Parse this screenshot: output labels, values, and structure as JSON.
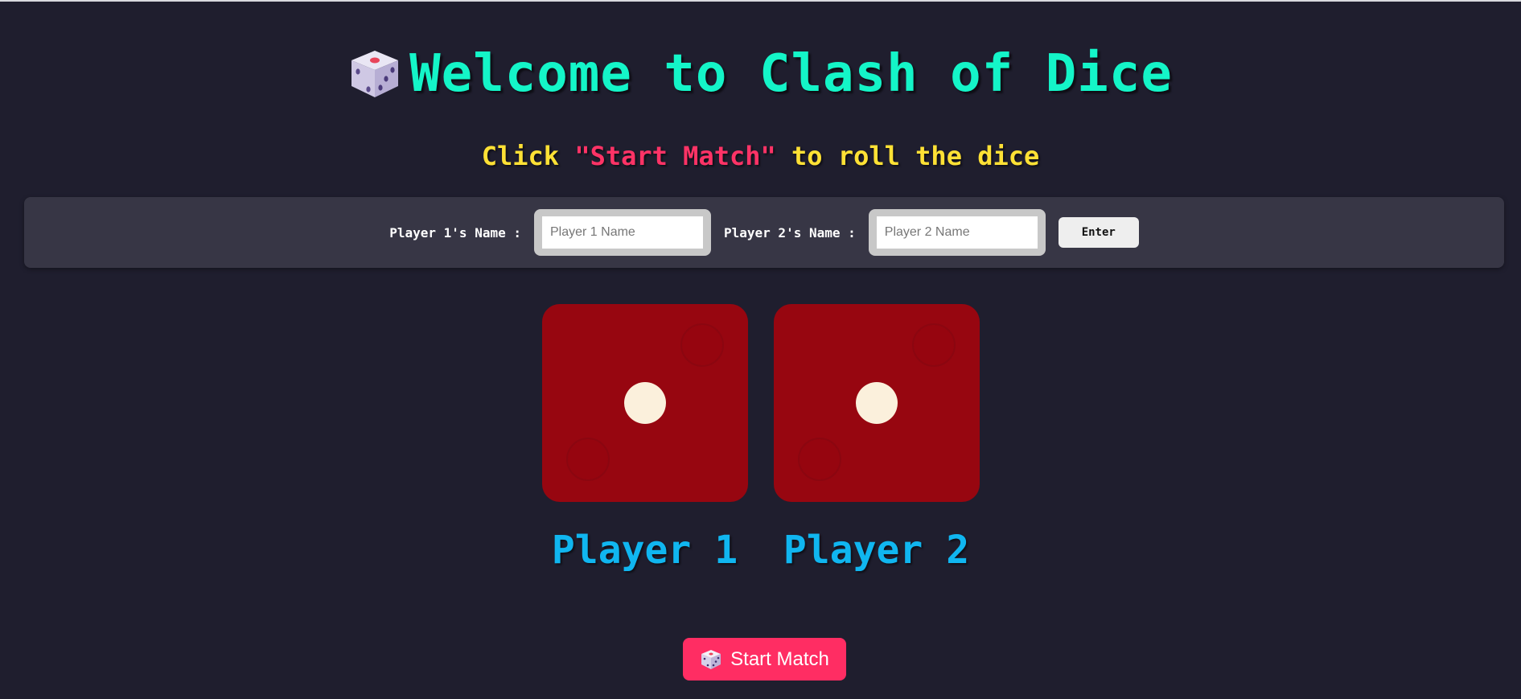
{
  "header": {
    "title": "Welcome to Clash of Dice",
    "title_icon": "dice-icon",
    "subtitle_prefix": "Click ",
    "subtitle_highlight": "\"Start Match\"",
    "subtitle_suffix": " to roll the dice"
  },
  "names_form": {
    "player1_label": "Player 1's Name :",
    "player1_placeholder": "Player 1 Name",
    "player1_value": "",
    "player2_label": "Player 2's Name :",
    "player2_placeholder": "Player 2 Name",
    "player2_value": "",
    "enter_label": "Enter"
  },
  "dice": [
    {
      "player": "Player 1",
      "value": 1
    },
    {
      "player": "Player 2",
      "value": 1
    }
  ],
  "start_button": {
    "label": "Start Match",
    "icon": "dice-icon"
  },
  "colors": {
    "background": "#1f1e2e",
    "title": "#14f5c8",
    "subtitle": "#ffe135",
    "highlight": "#ff3366",
    "die": "#970610",
    "pip": "#fbf0dc",
    "player_name": "#10b6f0",
    "start_button": "#ff2d63"
  }
}
